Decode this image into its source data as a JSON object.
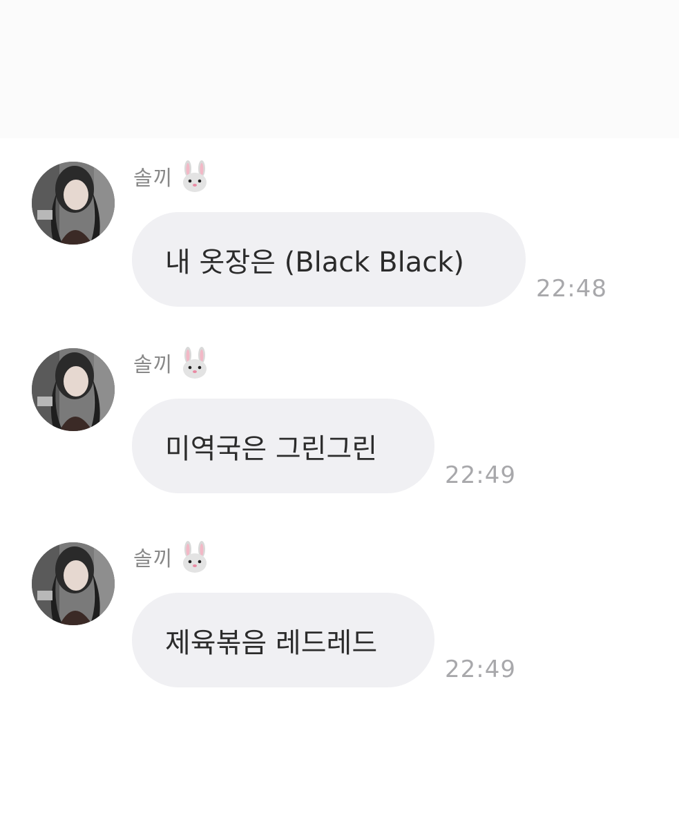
{
  "messages": [
    {
      "sender": "솔끼",
      "sender_emoji": "rabbit-face-icon",
      "text": "내 옷장은 (Black Black)",
      "time": "22:48"
    },
    {
      "sender": "솔끼",
      "sender_emoji": "rabbit-face-icon",
      "text": "미역국은 그린그린",
      "time": "22:49"
    },
    {
      "sender": "솔끼",
      "sender_emoji": "rabbit-face-icon",
      "text": "제육볶음 레드레드",
      "time": "22:49"
    }
  ],
  "colors": {
    "background": "#ffffff",
    "top_band": "#fbfbfb",
    "bubble": "#f0f0f3",
    "bubble_text": "#2b2b2b",
    "sender_name": "#888888",
    "timestamp": "#a8a8ab"
  }
}
